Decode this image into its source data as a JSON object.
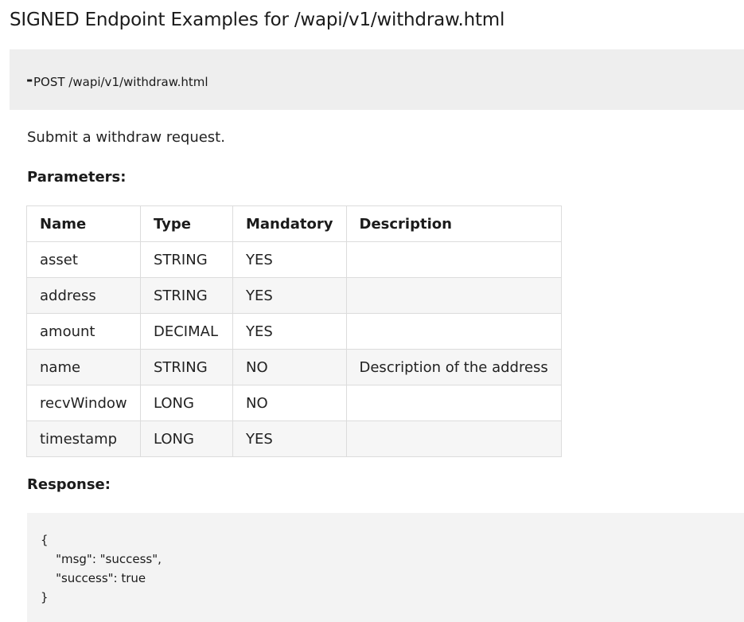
{
  "page": {
    "title": "SIGNED Endpoint Examples for /wapi/v1/withdraw.html"
  },
  "endpoint": {
    "toggle": "-",
    "label": "POST /wapi/v1/withdraw.html"
  },
  "description": "Submit a withdraw request.",
  "parameters": {
    "label": "Parameters:",
    "headers": [
      "Name",
      "Type",
      "Mandatory",
      "Description"
    ],
    "rows": [
      [
        "asset",
        "STRING",
        "YES",
        ""
      ],
      [
        "address",
        "STRING",
        "YES",
        ""
      ],
      [
        "amount",
        "DECIMAL",
        "YES",
        ""
      ],
      [
        "name",
        "STRING",
        "NO",
        "Description of the address"
      ],
      [
        "recvWindow",
        "LONG",
        "NO",
        ""
      ],
      [
        "timestamp",
        "LONG",
        "YES",
        ""
      ]
    ]
  },
  "response": {
    "label": "Response:",
    "code": "{\n    \"msg\": \"success\",\n    \"success\": true\n}"
  }
}
